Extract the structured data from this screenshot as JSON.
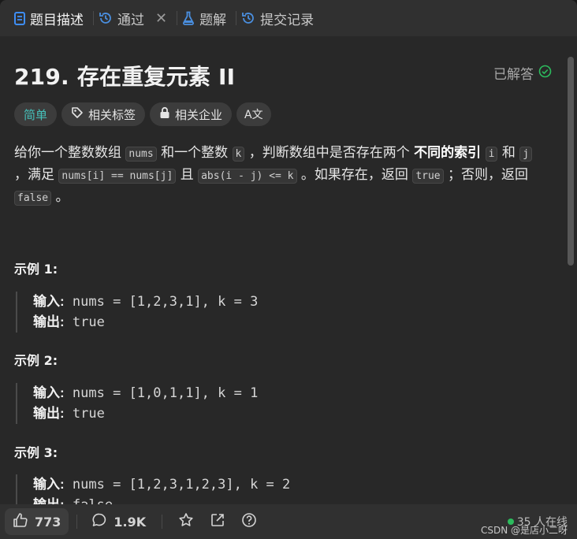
{
  "tabs": [
    {
      "label": "题目描述",
      "icon": "description-icon"
    },
    {
      "label": "通过",
      "icon": "history-icon"
    },
    {
      "label": "题解",
      "icon": "flask-icon"
    },
    {
      "label": "提交记录",
      "icon": "history-icon"
    }
  ],
  "tab_close": "✕",
  "problem": {
    "title": "219. 存在重复元素 II",
    "status": "已解答",
    "difficulty": "简单",
    "tags_label": "相关标签",
    "companies_label": "相关企业",
    "translate_label": "A文"
  },
  "description": {
    "p1": "给你一个整数数组",
    "c_nums": "nums",
    "p2": "和一个整数",
    "c_k": "k",
    "p3": "，判断数组中是否存在两个",
    "bold": "不同的索引",
    "c_i": "i",
    "p4": "和",
    "c_j": "j",
    "p5": "，满足",
    "c_eq": "nums[i] == nums[j]",
    "p6": "且",
    "c_abs": "abs(i - j) <= k",
    "p7": "。如果存在，返回",
    "c_true": "true",
    "p8": "；否则，返回",
    "c_false": "false",
    "p9": "。"
  },
  "examples": [
    {
      "title": "示例 1:",
      "input_label": "输入:",
      "input": "nums = [1,2,3,1], k = 3",
      "output_label": "输出:",
      "output": "true"
    },
    {
      "title": "示例 2:",
      "input_label": "输入:",
      "input": "nums = [1,0,1,1], k = 1",
      "output_label": "输出:",
      "output": "true"
    },
    {
      "title": "示例 3:",
      "input_label": "输入:",
      "input": "nums = [1,2,3,1,2,3], k = 2",
      "output_label": "输出:",
      "output": "false"
    }
  ],
  "bottom": {
    "likes": "773",
    "comments": "1.9K",
    "online": "35 人在线",
    "watermark": "CSDN @是店小二呀"
  },
  "colors": {
    "easy": "#46c0ba",
    "solved_check": "#2cbb5d",
    "active_tab_icon": "#3e8df5"
  }
}
